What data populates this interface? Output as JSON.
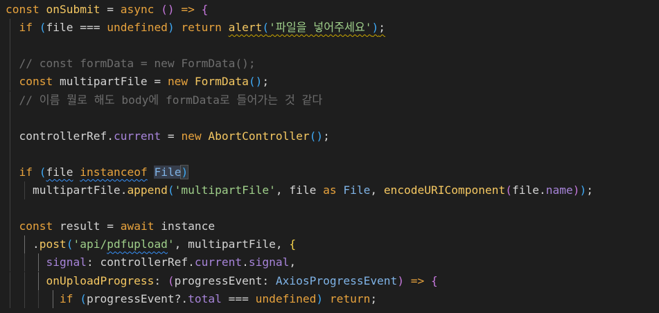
{
  "theme": {
    "background": "#1e1e1e",
    "default": "#d4d4d4",
    "keyword": "#e8a33d",
    "func": "#f5c862",
    "string": "#9fcf8a",
    "comment": "#6e6e6e",
    "prop": "#a784d9",
    "type": "#7fb3e6",
    "bracket": "#f7d44c",
    "bracket2": "#c678dd",
    "bracket3": "#3fa9f5"
  },
  "lines": [
    [
      {
        "t": "const ",
        "c": "keyword"
      },
      {
        "t": "onSubmit",
        "c": "func"
      },
      {
        "t": " = ",
        "c": "default"
      },
      {
        "t": "async",
        "c": "keyword"
      },
      {
        "t": " () ",
        "c": "bracket2"
      },
      {
        "t": "=> ",
        "c": "keyword"
      },
      {
        "t": "{",
        "c": "bracket2"
      }
    ],
    [
      {
        "t": "  "
      },
      {
        "t": "if ",
        "c": "keyword"
      },
      {
        "t": "(",
        "c": "bracket3"
      },
      {
        "t": "file",
        "c": "default"
      },
      {
        "t": " === ",
        "c": "default"
      },
      {
        "t": "undefined",
        "c": "keyword"
      },
      {
        "t": ")",
        "c": "bracket3"
      },
      {
        "t": " return ",
        "c": "keyword"
      },
      {
        "t": "alert",
        "c": "func",
        "sq": "warn"
      },
      {
        "t": "(",
        "c": "bracket3",
        "sq": "warn"
      },
      {
        "t": "'파일을 넣어주세요'",
        "c": "string",
        "sq": "warn"
      },
      {
        "t": ")",
        "c": "bracket3",
        "sq": "warn"
      },
      {
        "t": ";",
        "c": "default",
        "sq": "warn"
      }
    ],
    [],
    [
      {
        "t": "  "
      },
      {
        "t": "// const formData = new FormData();",
        "c": "comment"
      }
    ],
    [
      {
        "t": "  "
      },
      {
        "t": "const ",
        "c": "keyword"
      },
      {
        "t": "multipartFile",
        "c": "default"
      },
      {
        "t": " = ",
        "c": "default"
      },
      {
        "t": "new ",
        "c": "keyword"
      },
      {
        "t": "FormData",
        "c": "func"
      },
      {
        "t": "()",
        "c": "bracket3"
      },
      {
        "t": ";",
        "c": "default"
      }
    ],
    [
      {
        "t": "  "
      },
      {
        "t": "// 이름 뭘로 해도 body에 formData로 들어가는 것 같다",
        "c": "comment"
      }
    ],
    [],
    [
      {
        "t": "  "
      },
      {
        "t": "controllerRef",
        "c": "default"
      },
      {
        "t": ".",
        "c": "default"
      },
      {
        "t": "current",
        "c": "prop"
      },
      {
        "t": " = ",
        "c": "default"
      },
      {
        "t": "new ",
        "c": "keyword"
      },
      {
        "t": "AbortController",
        "c": "func"
      },
      {
        "t": "()",
        "c": "bracket3"
      },
      {
        "t": ";",
        "c": "default"
      }
    ],
    [],
    [
      {
        "t": "  "
      },
      {
        "t": "if ",
        "c": "keyword"
      },
      {
        "t": "(",
        "c": "bracket3"
      },
      {
        "t": "file",
        "c": "default",
        "sq": "info"
      },
      {
        "t": " ",
        "c": "default"
      },
      {
        "t": "instanceof",
        "c": "keyword",
        "sq": "info"
      },
      {
        "t": " ",
        "c": "default"
      },
      {
        "t": "File",
        "c": "type",
        "hl": "sel"
      },
      {
        "t": ")",
        "c": "bracket3",
        "hl": "box"
      }
    ],
    [
      {
        "t": "    "
      },
      {
        "t": "multipartFile",
        "c": "default"
      },
      {
        "t": ".",
        "c": "default"
      },
      {
        "t": "append",
        "c": "func"
      },
      {
        "t": "(",
        "c": "bracket3"
      },
      {
        "t": "'multipartFile'",
        "c": "string"
      },
      {
        "t": ", ",
        "c": "default"
      },
      {
        "t": "file",
        "c": "default"
      },
      {
        "t": " as ",
        "c": "keyword"
      },
      {
        "t": "File",
        "c": "type"
      },
      {
        "t": ", ",
        "c": "default"
      },
      {
        "t": "encodeURIComponent",
        "c": "func"
      },
      {
        "t": "(",
        "c": "bracket2"
      },
      {
        "t": "file",
        "c": "default"
      },
      {
        "t": ".",
        "c": "default"
      },
      {
        "t": "name",
        "c": "prop"
      },
      {
        "t": ")",
        "c": "bracket2"
      },
      {
        "t": ")",
        "c": "bracket3"
      },
      {
        "t": ";",
        "c": "default"
      }
    ],
    [],
    [
      {
        "t": "  "
      },
      {
        "t": "const ",
        "c": "keyword"
      },
      {
        "t": "result",
        "c": "default"
      },
      {
        "t": " = ",
        "c": "default"
      },
      {
        "t": "await ",
        "c": "keyword"
      },
      {
        "t": "instance",
        "c": "default"
      }
    ],
    [
      {
        "t": "    "
      },
      {
        "t": ".",
        "c": "default"
      },
      {
        "t": "post",
        "c": "func"
      },
      {
        "t": "(",
        "c": "bracket3"
      },
      {
        "t": "'api/",
        "c": "string"
      },
      {
        "t": "pdfupload",
        "c": "string",
        "sq": "info"
      },
      {
        "t": "'",
        "c": "string"
      },
      {
        "t": ", ",
        "c": "default"
      },
      {
        "t": "multipartFile",
        "c": "default"
      },
      {
        "t": ", ",
        "c": "default"
      },
      {
        "t": "{",
        "c": "bracket"
      }
    ],
    [
      {
        "t": "      "
      },
      {
        "t": "signal",
        "c": "prop"
      },
      {
        "t": ": ",
        "c": "default"
      },
      {
        "t": "controllerRef",
        "c": "default"
      },
      {
        "t": ".",
        "c": "default"
      },
      {
        "t": "current",
        "c": "prop"
      },
      {
        "t": ".",
        "c": "default"
      },
      {
        "t": "signal",
        "c": "prop"
      },
      {
        "t": ",",
        "c": "default"
      }
    ],
    [
      {
        "t": "      "
      },
      {
        "t": "onUploadProgress",
        "c": "func"
      },
      {
        "t": ": ",
        "c": "default"
      },
      {
        "t": "(",
        "c": "bracket2"
      },
      {
        "t": "progressEvent",
        "c": "default"
      },
      {
        "t": ": ",
        "c": "default"
      },
      {
        "t": "AxiosProgressEvent",
        "c": "type"
      },
      {
        "t": ")",
        "c": "bracket2"
      },
      {
        "t": " => ",
        "c": "keyword"
      },
      {
        "t": "{",
        "c": "bracket2"
      }
    ],
    [
      {
        "t": "        "
      },
      {
        "t": "if ",
        "c": "keyword"
      },
      {
        "t": "(",
        "c": "bracket3"
      },
      {
        "t": "progressEvent",
        "c": "default"
      },
      {
        "t": "?.",
        "c": "default"
      },
      {
        "t": "total",
        "c": "prop"
      },
      {
        "t": " === ",
        "c": "default"
      },
      {
        "t": "undefined",
        "c": "keyword"
      },
      {
        "t": ")",
        "c": "bracket3"
      },
      {
        "t": " return",
        "c": "keyword"
      },
      {
        "t": ";",
        "c": "default"
      }
    ]
  ]
}
